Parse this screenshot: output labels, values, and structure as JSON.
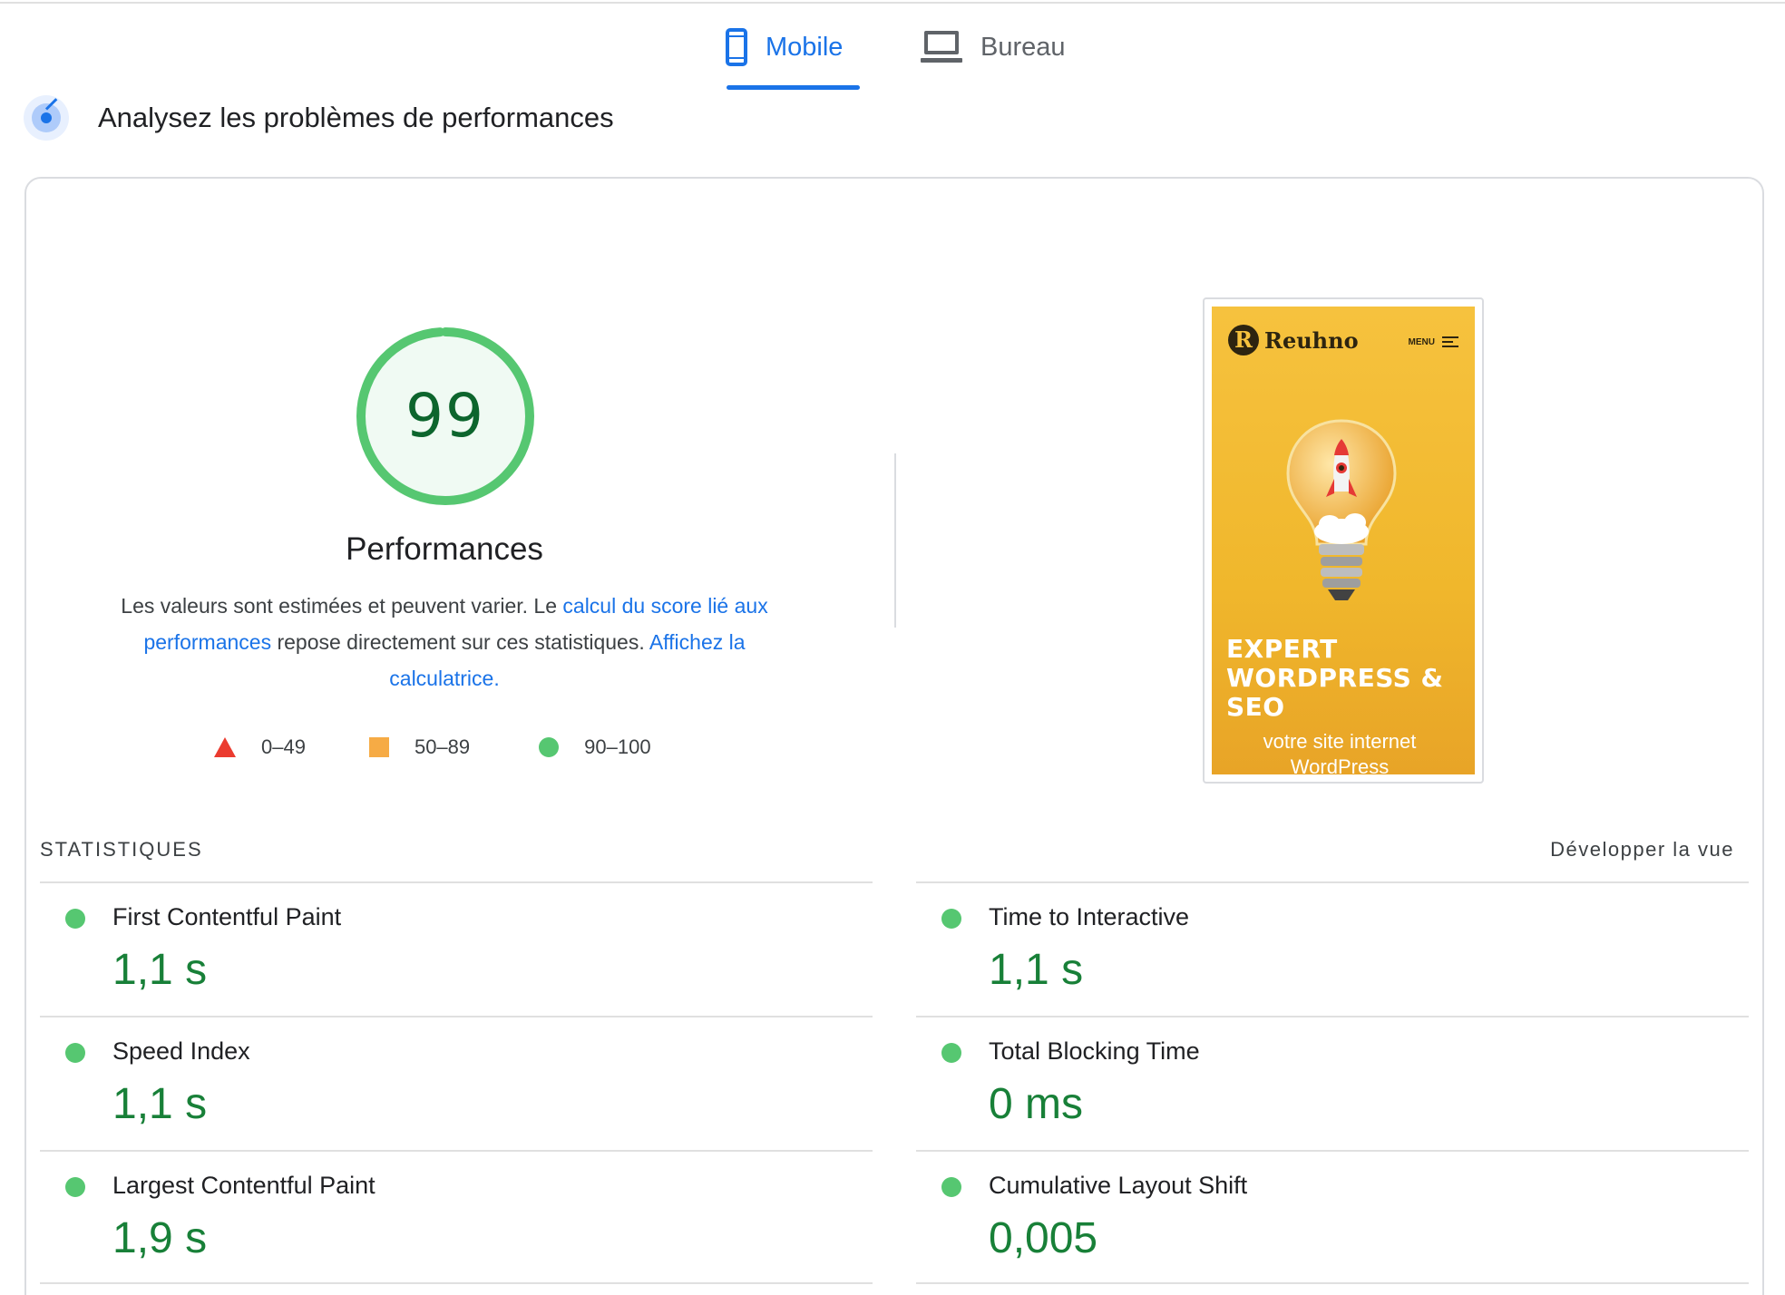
{
  "tabs": [
    {
      "label": "Mobile",
      "icon": "phone-icon",
      "active": true
    },
    {
      "label": "Bureau",
      "icon": "laptop-icon",
      "active": false
    }
  ],
  "section": {
    "title": "Analysez les problèmes de performances",
    "icon": "radar-icon"
  },
  "score": {
    "value": 99,
    "value_text": "99",
    "title": "Performances",
    "color": "#56c771"
  },
  "description": {
    "part1": "Les valeurs sont estimées et peuvent varier. Le ",
    "link1": "calcul du score lié aux performances",
    "part2": " repose directement sur ces statistiques. ",
    "link2": "Affichez la calculatrice."
  },
  "legend": [
    {
      "label": "0–49",
      "icon": "triangle-icon",
      "color": "#eb3b2f"
    },
    {
      "label": "50–89",
      "icon": "square-icon",
      "color": "#f6ab45"
    },
    {
      "label": "90–100",
      "icon": "circle-icon",
      "color": "#56c771"
    }
  ],
  "screenshot": {
    "logo_letter": "R",
    "logo_text": "Reuhno",
    "menu_label": "MENU",
    "headline": "EXPERT WORDPRESS & SEO",
    "subline": "votre site internet WordPress"
  },
  "stats": {
    "heading": "STATISTIQUES",
    "expand_label": "Développer la vue",
    "metrics": [
      {
        "label": "First Contentful Paint",
        "value": "1,1 s"
      },
      {
        "label": "Time to Interactive",
        "value": "1,1 s"
      },
      {
        "label": "Speed Index",
        "value": "1,1 s"
      },
      {
        "label": "Total Blocking Time",
        "value": "0 ms"
      },
      {
        "label": "Largest Contentful Paint",
        "value": "1,9 s"
      },
      {
        "label": "Cumulative Layout Shift",
        "value": "0,005"
      }
    ]
  }
}
